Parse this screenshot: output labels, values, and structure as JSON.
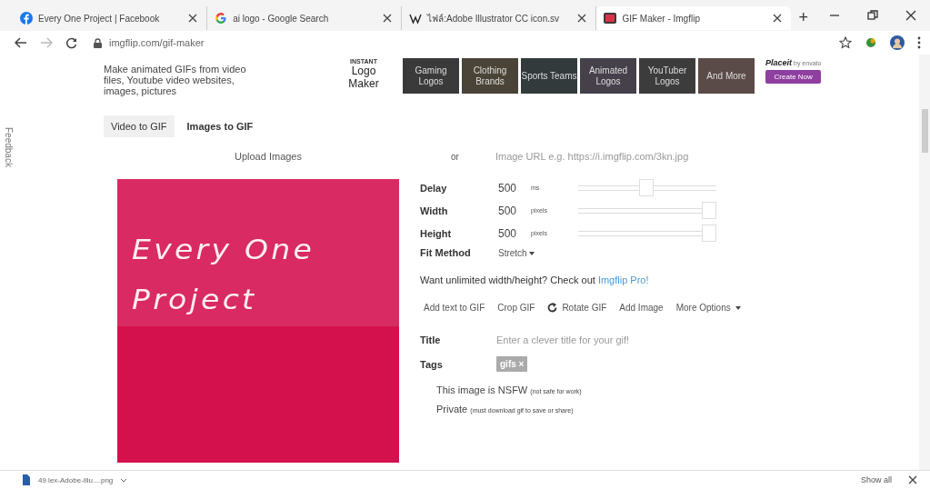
{
  "browser_tabs": [
    {
      "title": "Every One Project | Facebook",
      "kind": "facebook",
      "selected": false
    },
    {
      "title": "ai logo - Google Search",
      "kind": "google",
      "selected": false
    },
    {
      "title": "ไฟล์:Adobe Illustrator CC icon.sv",
      "kind": "wikipedia",
      "selected": false
    },
    {
      "title": "GIF Maker - Imgflip",
      "kind": "imgflip",
      "selected": true
    }
  ],
  "new_tab": "+",
  "address_bar": {
    "url": "imgflip.com/gif-maker"
  },
  "feedback": "Feedback",
  "header": {
    "tagline": "Make animated GIFs from video files, Youtube video websites, images, pictures",
    "logo_maker": {
      "caption": "INSTANT",
      "title": "Logo Maker"
    },
    "tiles": [
      {
        "label": "Gaming Logos",
        "color": "#3a3a3a"
      },
      {
        "label": "Clothing Brands",
        "color": "#4a4438"
      },
      {
        "label": "Sports Teams",
        "color": "#333a3c"
      },
      {
        "label": "Animated Logos",
        "color": "#45404a"
      },
      {
        "label": "YouTuber Logos",
        "color": "#3c3c3c"
      },
      {
        "label": "And More",
        "color": "#5a4a48"
      }
    ],
    "placeit": {
      "brand": "Placeit",
      "by": "by envato",
      "button": "Create Now"
    }
  },
  "mode_tabs": [
    {
      "label": "Video to GIF",
      "selected": false
    },
    {
      "label": "Images to GIF",
      "selected": true
    }
  ],
  "upload": {
    "button": "Upload Images",
    "or": "or",
    "url_placeholder": "Image URL e.g. https://i.imgflip.com/3kn.jpg"
  },
  "preview": {
    "lines": [
      "Every One",
      "Project"
    ]
  },
  "settings": [
    {
      "label": "Delay",
      "value": "500",
      "unit": "ms",
      "level": 0.49
    },
    {
      "label": "Width",
      "value": "500",
      "unit": "pixels",
      "level": 1
    },
    {
      "label": "Height",
      "value": "500",
      "unit": "pixels",
      "level": 1
    }
  ],
  "fit_method": {
    "label": "Fit Method",
    "value": "Stretch"
  },
  "pro_note": {
    "text": "Want unlimited width/height? Check out ",
    "link": "Imgflip Pro!"
  },
  "actions": [
    {
      "label": "Add text to GIF",
      "kind": "plain"
    },
    {
      "label": "Crop GIF",
      "kind": "plain"
    },
    {
      "label": "Rotate GIF",
      "kind": "rotate"
    },
    {
      "label": "Add Image",
      "kind": "plain"
    },
    {
      "label": "More Options",
      "kind": "dropdown"
    }
  ],
  "title_field": {
    "label": "Title",
    "placeholder": "Enter a clever title for your gif!"
  },
  "tags": {
    "label": "Tags",
    "items": [
      "gifs ×"
    ]
  },
  "options": [
    {
      "label": "This image is NSFW",
      "note": "(not safe for work)"
    },
    {
      "label": "Private",
      "note": "(must download gif to save or share)"
    }
  ],
  "download_bar": {
    "file": "49 lex-Adobe-Illu....png",
    "show_all": "Show all"
  }
}
